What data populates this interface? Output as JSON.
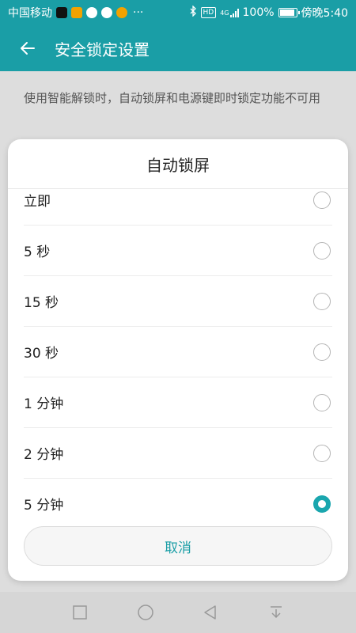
{
  "status_bar": {
    "carrier": "中国移动",
    "more": "···",
    "hd": "HD",
    "network": "4G",
    "battery": "100%",
    "time": "傍晚5:40",
    "app_icons": [
      "tiktok-icon",
      "video-icon",
      "location-icon",
      "wechat-icon",
      "money-icon"
    ]
  },
  "app_bar": {
    "title": "安全锁定设置"
  },
  "page": {
    "description": "使用智能解锁时，自动锁屏和电源键即时锁定功能不可用"
  },
  "dialog": {
    "title": "自动锁屏",
    "options": [
      {
        "label": "立即",
        "selected": false
      },
      {
        "label": "5 秒",
        "selected": false
      },
      {
        "label": "15 秒",
        "selected": false
      },
      {
        "label": "30 秒",
        "selected": false
      },
      {
        "label": "1 分钟",
        "selected": false
      },
      {
        "label": "2 分钟",
        "selected": false
      },
      {
        "label": "5 分钟",
        "selected": true
      }
    ],
    "cancel_label": "取消"
  },
  "colors": {
    "accent": "#1a9ea6"
  }
}
